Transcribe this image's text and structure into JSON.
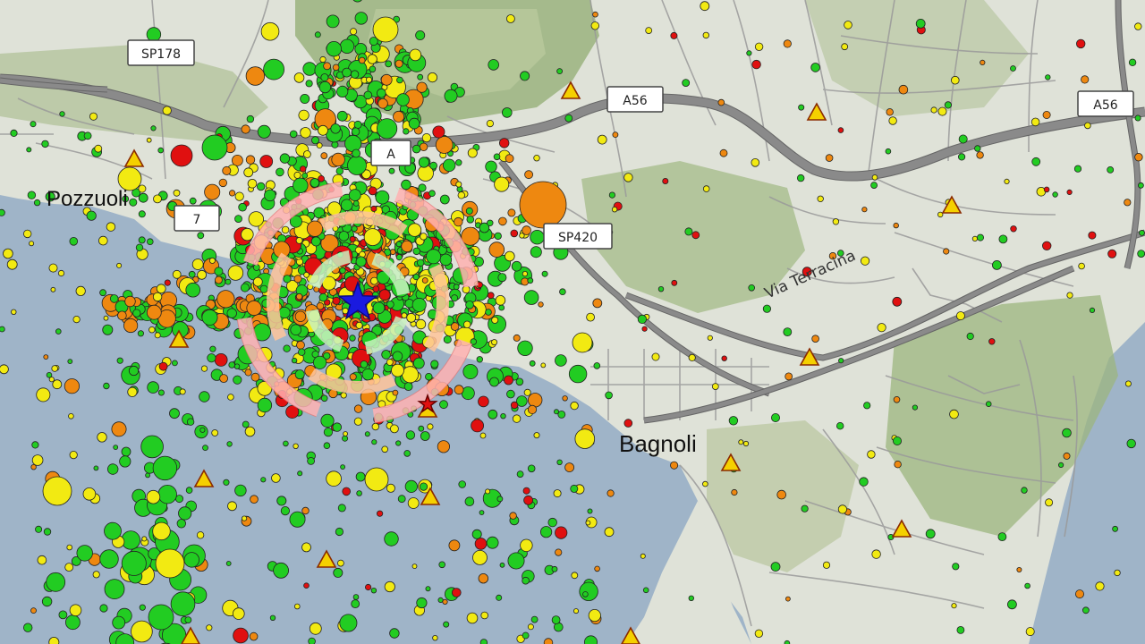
{
  "map": {
    "colors": {
      "sea": "#9fb4c8",
      "land": "#dfe2d8",
      "hills": "#a9bd8e",
      "road_major": "#777777",
      "road_minor": "#9a9a9a",
      "quake_green": "#22cc22",
      "quake_yellow": "#f2ea12",
      "quake_orange": "#ee8810",
      "quake_red": "#e01010",
      "station": "#f5d000",
      "epicenter": "#1a1adf"
    },
    "place_labels": [
      {
        "id": "pozzuoli",
        "text": "Pozzuoli"
      },
      {
        "id": "bagnoli",
        "text": "Bagnoli"
      }
    ],
    "street_labels": [
      {
        "id": "via-terracina",
        "text": "Via  Terracina"
      }
    ],
    "road_shields": [
      {
        "id": "sp178",
        "text": "SP178"
      },
      {
        "id": "a56-west",
        "text": "A56"
      },
      {
        "id": "a56-east",
        "text": "A56"
      },
      {
        "id": "sp420",
        "text": "SP420"
      },
      {
        "id": "a-center",
        "text": "A"
      },
      {
        "id": "sp7",
        "text": "7"
      }
    ],
    "legend_levels": [
      "green",
      "yellow",
      "orange",
      "red"
    ]
  }
}
